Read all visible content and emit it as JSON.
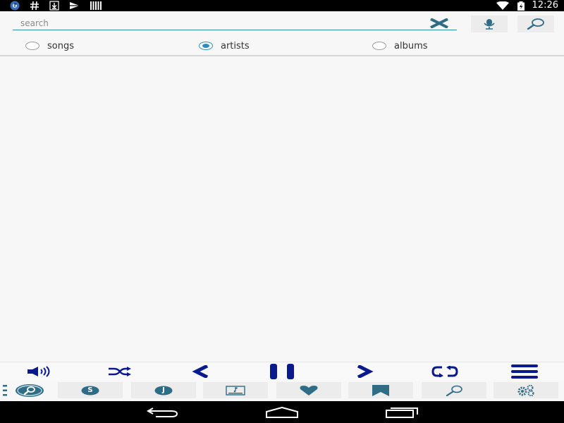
{
  "status_bar": {
    "time": "12:26",
    "left_icons": [
      "music-app-icon",
      "hash-icon",
      "download-icon",
      "play-store-icon",
      "barcode-icon"
    ],
    "right_icons": [
      "wifi-icon",
      "battery-icon"
    ]
  },
  "search": {
    "placeholder": "search",
    "value": "",
    "clear_icon": "close-icon",
    "voice_icon": "microphone-icon",
    "submit_icon": "search-icon"
  },
  "filters": [
    {
      "label": "songs",
      "checked": false
    },
    {
      "label": "artists",
      "checked": true
    },
    {
      "label": "albums",
      "checked": false
    }
  ],
  "player_controls": [
    "volume-icon",
    "shuffle-icon",
    "previous-icon",
    "pause-icon",
    "next-icon",
    "repeat-icon",
    "menu-icon"
  ],
  "bottom_tabs": [
    {
      "icon": "search-tab-icon",
      "label": "",
      "active": true
    },
    {
      "icon": "badge-icon",
      "label": "S",
      "active": false
    },
    {
      "icon": "badge-icon",
      "label": "J",
      "active": false
    },
    {
      "icon": "playlist-icon",
      "label": "",
      "active": false
    },
    {
      "icon": "heart-icon",
      "label": "",
      "active": false
    },
    {
      "icon": "bookmark-icon",
      "label": "",
      "active": false
    },
    {
      "icon": "magnifier-icon",
      "label": "",
      "active": false
    },
    {
      "icon": "settings-icon",
      "label": "",
      "active": false
    }
  ],
  "navigation": [
    "back-icon",
    "home-icon",
    "recents-icon"
  ],
  "colors": {
    "accent": "#2a8bc0",
    "icon_dark_blue": "#0a1a8c",
    "icon_teal": "#2f6c86",
    "status_bar": "#000000",
    "background": "#f7f7f7"
  }
}
